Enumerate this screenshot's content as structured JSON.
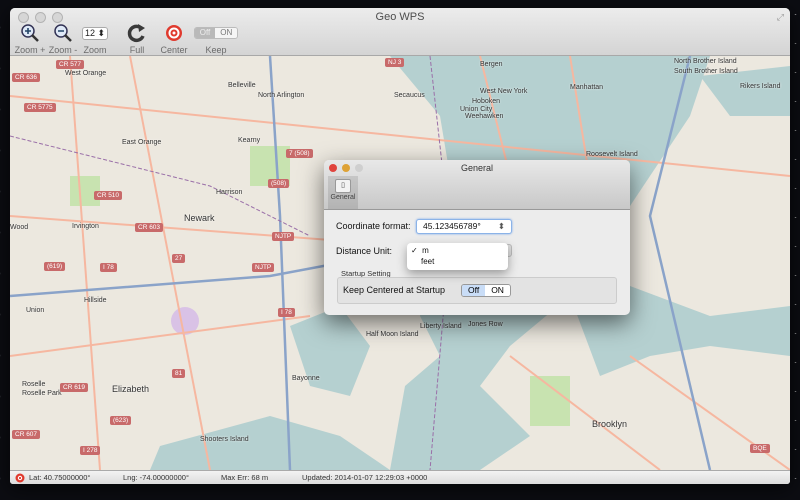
{
  "window": {
    "title": "Geo WPS"
  },
  "toolbar": {
    "zoom_in": "Zoom +",
    "zoom_out": "Zoom -",
    "zoom_value": "12",
    "zoom": "Zoom",
    "full_refresh": "Full Refresh",
    "center": "Center",
    "keep_centered": "Keep Centered",
    "keep_centered_off": "Off",
    "keep_centered_on": "ON",
    "keep_centered_state": "Off"
  },
  "map": {
    "places": [
      "West Orange",
      "Belleville",
      "North Arlington",
      "Secaucus",
      "Bergen",
      "Union City",
      "West New York",
      "Weehawken",
      "Manhattan",
      "East Orange",
      "Kearny",
      "Harrison",
      "Newark",
      "Irvington",
      "Hillside",
      "Union",
      "Elizabeth",
      "Roselle Park",
      "Bayonne",
      "Brooklyn",
      "Roosevelt Island",
      "North Brother Island",
      "South Brother Island",
      "Rikers Island",
      "Shooters Island",
      "Liberty Island",
      "Jones Row",
      "Half Moon Island",
      "Roselle",
      "Hoboken",
      "Wood"
    ],
    "shields": [
      "CR 636",
      "CR 5775",
      "CR 577",
      "CR 510",
      "CR 603",
      "(619)",
      "I 78",
      "I 78",
      "NJTP",
      "NJTP",
      "NJ 3",
      "7 (508)",
      "(508)",
      "CR 619",
      "CR 607",
      "I 278",
      "(623)",
      "27",
      "81",
      "BQE"
    ]
  },
  "status": {
    "lat": "Lat: 40.75000000°",
    "lng": "Lng: -74.00000000°",
    "max_err": "Max Err: 68 m",
    "updated": "Updated: 2014-01-07 12:29:03 +0000"
  },
  "dialog": {
    "title": "General",
    "tab": "General",
    "coordinate_label": "Coordinate format:",
    "coordinate_value": "45.123456789°",
    "distance_label": "Distance Unit:",
    "distance_options": [
      "m",
      "feet"
    ],
    "distance_selected": "m",
    "check": "✓",
    "group_title": "Startup Setting",
    "startup_label": "Keep Centered at Startup",
    "off": "Off",
    "on": "ON",
    "startup_state": "Off"
  },
  "colors": {
    "water": "#b5d0d0",
    "park": "#c8e3b0",
    "road_major": "#f6b7a0",
    "road_motorway": "#8aa3c9",
    "boundary": "#9a6fa8",
    "center_red": "#e03a2e"
  }
}
